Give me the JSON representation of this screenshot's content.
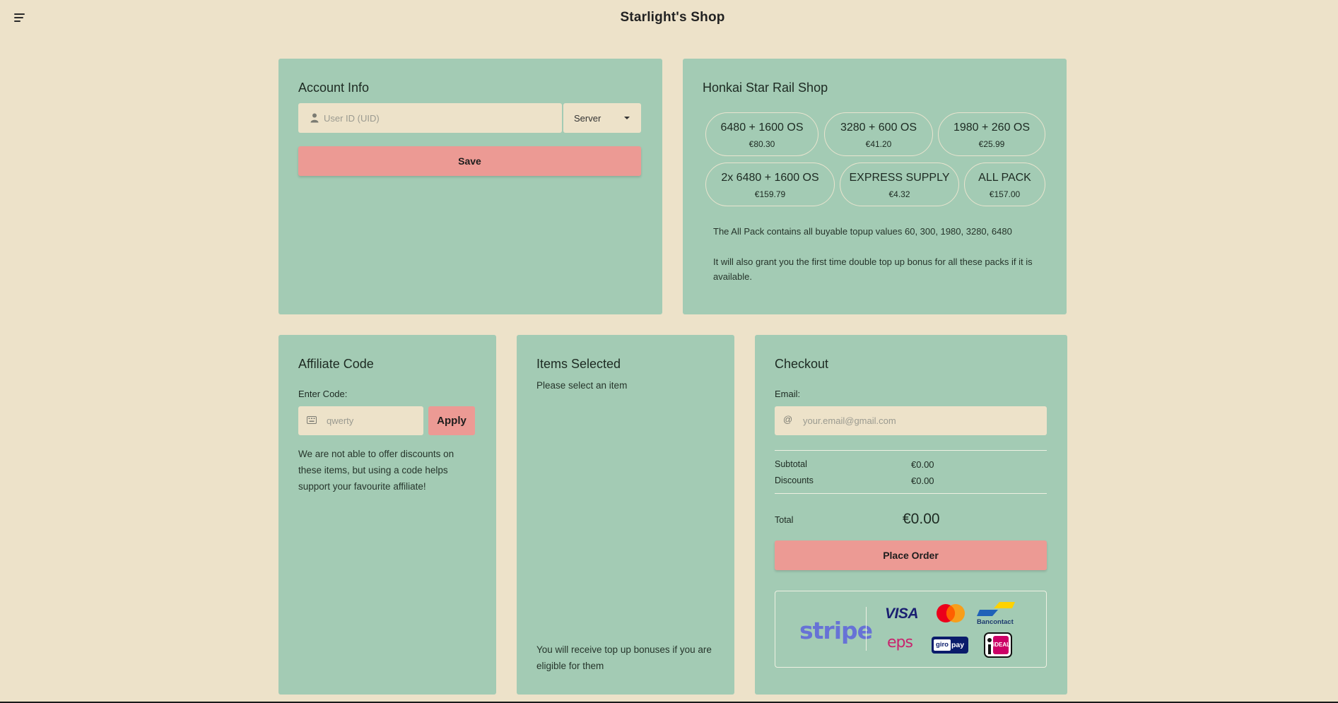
{
  "header": {
    "title": "Starlight's Shop",
    "menu_icon": "menu-icon"
  },
  "account": {
    "title": "Account Info",
    "uid_placeholder": "User ID (UID)",
    "uid_value": "",
    "server_label": "Server",
    "save_label": "Save"
  },
  "shop": {
    "title": "Honkai Star Rail Shop",
    "packs": [
      {
        "name": "6480 + 1600 OS",
        "price": "€80.30"
      },
      {
        "name": "3280 + 600 OS",
        "price": "€41.20"
      },
      {
        "name": "1980 + 260 OS",
        "price": "€25.99"
      },
      {
        "name": "2x 6480 + 1600 OS",
        "price": "€159.79"
      },
      {
        "name": "EXPRESS SUPPLY",
        "price": "€4.32"
      },
      {
        "name": "ALL PACK",
        "price": "€157.00"
      }
    ],
    "note1": "The All Pack contains all buyable topup values 60, 300, 1980, 3280, 6480",
    "note2": "It will also grant you the first time double top up bonus for all these packs if it is available."
  },
  "affiliate": {
    "title": "Affiliate Code",
    "label": "Enter Code:",
    "placeholder": "qwerty",
    "value": "",
    "apply_label": "Apply",
    "note": "We are not able to offer discounts on these items, but using a code helps support your favourite affiliate!"
  },
  "items": {
    "title": "Items Selected",
    "empty_text": "Please select an item",
    "note": "You will receive top up bonuses if you are eligible for them"
  },
  "checkout": {
    "title": "Checkout",
    "email_label": "Email:",
    "email_placeholder": "your.email@gmail.com",
    "email_value": "",
    "subtotal_label": "Subtotal",
    "subtotal_value": "€0.00",
    "discounts_label": "Discounts",
    "discounts_value": "€0.00",
    "total_label": "Total",
    "total_value": "€0.00",
    "order_label": "Place Order",
    "payment_logos": {
      "stripe": "stripe",
      "visa": "VISA",
      "mastercard": "mastercard-logo",
      "bancontact": "Bancontact",
      "eps": "eps",
      "giropay_a": "giro",
      "giropay_b": "pay",
      "ideal": "iDEAL"
    }
  },
  "colors": {
    "background": "#ede2c9",
    "card": "#a3cbb4",
    "button": "#ec9a94",
    "stripe": "#6772d6",
    "visa": "#1a1f71",
    "eps": "#c8246e",
    "giropay": "#0a1c6b",
    "ideal": "#cc0066"
  }
}
